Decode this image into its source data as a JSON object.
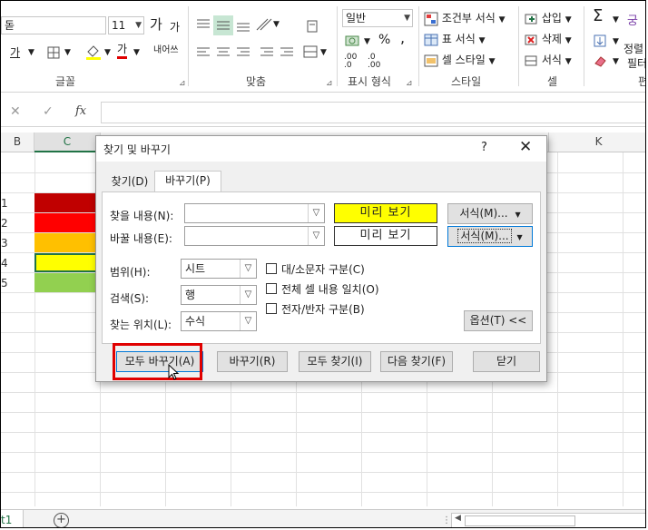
{
  "ribbon": {
    "font_name": "돋",
    "font_size": "11",
    "grow_font": "가",
    "shrink_font": "가",
    "underline": "가",
    "font_color_letter": "가",
    "wrap_text": "내어쓰",
    "number_format": "일반",
    "percent": "%",
    "comma": ",",
    "dec_inc": ".00 .0",
    "dec_dec": ".0 .00",
    "conditional_format": "조건부 서식",
    "table_format": "표 서식",
    "cell_style": "셀 스타일",
    "insert": "삽입",
    "delete": "삭제",
    "format": "서식",
    "sort_filter_1": "정렬",
    "sort_filter_2": "필터",
    "groups": {
      "font": "글꼴",
      "alignment": "맞춤",
      "number": "표시 형식",
      "style": "스타일",
      "cells": "셀",
      "edit": "편"
    }
  },
  "formula_bar": {
    "cancel": "✕",
    "enter": "✓",
    "fx": "fx"
  },
  "grid": {
    "col_b": "B",
    "col_c": "C",
    "col_k": "K",
    "rows": [
      "1",
      "2",
      "3",
      "4",
      "5"
    ],
    "cell_colors": [
      "#c00000",
      "#ff0000",
      "#ffc000",
      "#ffff00",
      "#92d050"
    ]
  },
  "sheet": {
    "tab_label": "t1",
    "add_sheet": "+"
  },
  "dialog": {
    "title": "찾기 및 바꾸기",
    "help": "?",
    "close": "✕",
    "tabs": {
      "find": "찾기(D)",
      "replace": "바꾸기(P)"
    },
    "find_what_label": "찾을 내용(N):",
    "replace_with_label": "바꿀 내용(E):",
    "find_what_value": "",
    "replace_with_value": "",
    "preview_find": "미리 보기",
    "preview_replace": "미리 보기",
    "format_btn_1": "서식(M)...",
    "format_btn_2": "서식(M)...",
    "within_label": "범위(H):",
    "within_value": "시트",
    "search_label": "검색(S):",
    "search_value": "행",
    "lookin_label": "찾는 위치(L):",
    "lookin_value": "수식",
    "match_case": "대/소문자 구분(C)",
    "match_entire": "전체 셀 내용 일치(O)",
    "match_byte": "전자/반자 구분(B)",
    "options_btn": "옵션(T) <<",
    "replace_all": "모두 바꾸기(A)",
    "replace": "바꾸기(R)",
    "find_all": "모두 찾기(I)",
    "find_next": "다음 찾기(F)",
    "close_btn": "닫기",
    "preview_find_color": "#ffff00"
  }
}
